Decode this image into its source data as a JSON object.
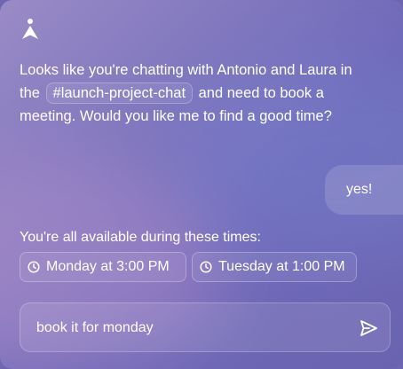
{
  "assistant": {
    "message_before_tag": "Looks like you're chatting with Antonio and Laura in the",
    "channel_tag": "#launch-project-chat",
    "message_after_tag": "and need to book a meeting. Would you like me to find a good time?"
  },
  "user_reply": "yes!",
  "availability": {
    "heading": "You're all available during these times:",
    "slots": [
      "Monday at 3:00 PM",
      "Tuesday at 1:00 PM"
    ]
  },
  "composer": {
    "value": "book it for monday"
  },
  "icons": {
    "logo": "assistant-logo-icon",
    "slot": "clock-icon",
    "send": "send-icon"
  }
}
